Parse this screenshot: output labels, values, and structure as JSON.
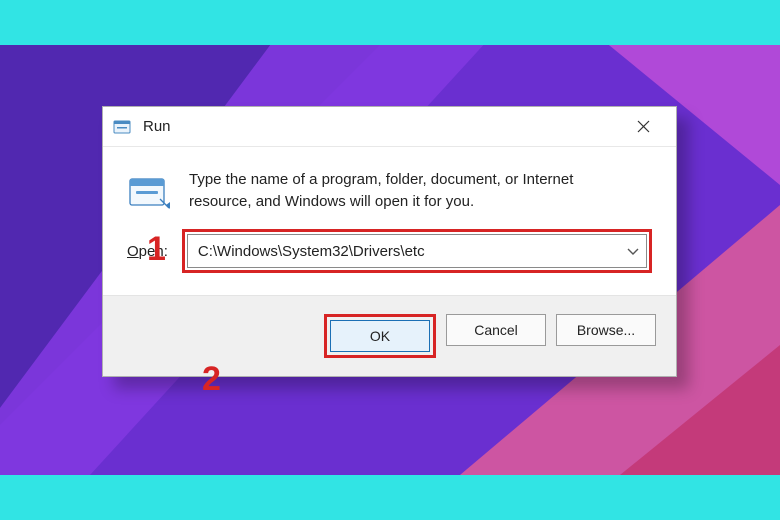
{
  "dialog": {
    "title": "Run",
    "description": "Type the name of a program, folder, document, or Internet resource, and Windows will open it for you.",
    "open_label_prefix": "O",
    "open_label_rest": "pen:",
    "input_value": "C:\\Windows\\System32\\Drivers\\etc"
  },
  "buttons": {
    "ok": "OK",
    "cancel": "Cancel",
    "browse": "Browse..."
  },
  "annotations": {
    "one": "1",
    "two": "2"
  }
}
